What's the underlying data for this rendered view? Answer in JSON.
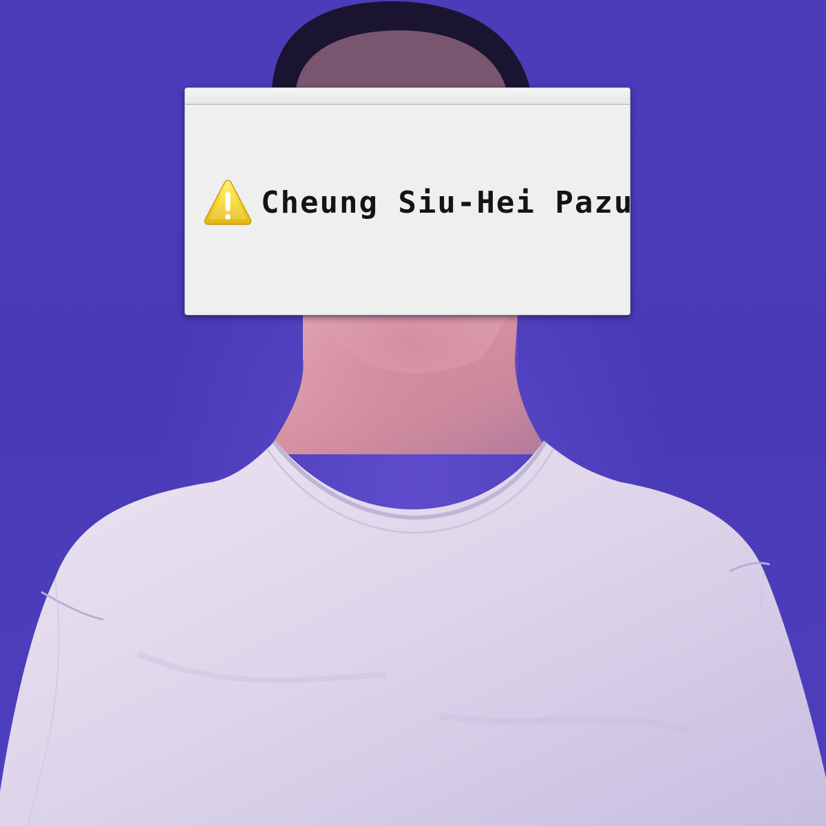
{
  "alert": {
    "icon": "warning-icon",
    "message": "Cheung Siu-Hei Pazu"
  },
  "colors": {
    "background": "#4a3bb8",
    "shirt": "#d9cfe6",
    "skin": "#d99aa8",
    "hair": "#1a1430",
    "warning_fill": "#f5d21f"
  }
}
